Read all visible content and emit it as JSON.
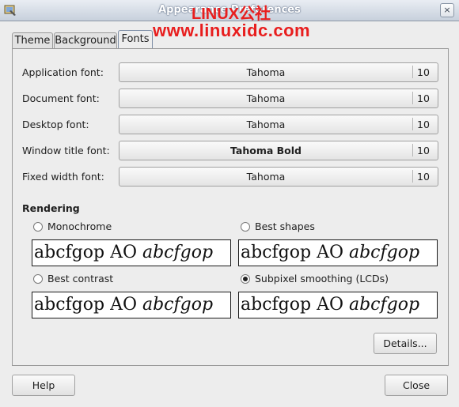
{
  "window": {
    "title": "Appearance Preferences",
    "close_glyph": "×"
  },
  "watermark": {
    "line1": "LINUX公社",
    "line2": "www.linuxidc.com"
  },
  "tabs": [
    {
      "label": "Theme"
    },
    {
      "label": "Background"
    },
    {
      "label": "Fonts",
      "active": true
    }
  ],
  "fonts": {
    "application": {
      "label": "Application font:",
      "family": "Tahoma",
      "size": "10"
    },
    "document": {
      "label": "Document font:",
      "family": "Tahoma",
      "size": "10"
    },
    "desktop": {
      "label": "Desktop font:",
      "family": "Tahoma",
      "size": "10"
    },
    "window_title": {
      "label": "Window title font:",
      "family": "Tahoma Bold",
      "size": "10"
    },
    "fixed_width": {
      "label": "Fixed width font:",
      "family": "Tahoma",
      "size": "10"
    }
  },
  "rendering": {
    "heading": "Rendering",
    "options": {
      "monochrome": {
        "label": "Monochrome",
        "selected": false
      },
      "best_shapes": {
        "label": "Best shapes",
        "selected": false
      },
      "best_contrast": {
        "label": "Best contrast",
        "selected": false
      },
      "subpixel": {
        "label": "Subpixel smoothing (LCDs)",
        "selected": true
      }
    },
    "sample_plain": "abcfgop AO ",
    "sample_italic": "abcfgop"
  },
  "buttons": {
    "details": "Details...",
    "help": "Help",
    "close": "Close"
  },
  "colors": {
    "watermark": "#e81e1e",
    "active_tab_border": "#7e8ea6"
  }
}
